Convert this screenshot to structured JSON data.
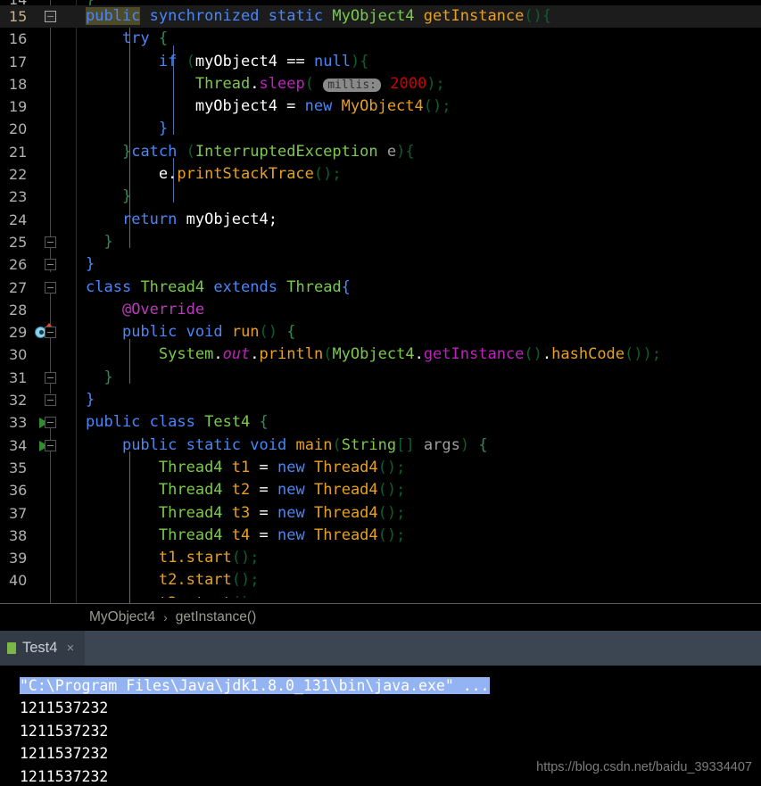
{
  "editor": {
    "current_line": 15,
    "first_partial_line": 14,
    "lines": [
      {
        "num": 15,
        "text": "public synchronized static MyObject4 getInstance(){"
      },
      {
        "num": 16,
        "text": "    try {"
      },
      {
        "num": 17,
        "text": "        if (myObject4 == null){"
      },
      {
        "num": 18,
        "text": "            Thread.sleep( millis: 2000);"
      },
      {
        "num": 19,
        "text": "            myObject4 = new MyObject4();"
      },
      {
        "num": 20,
        "text": "        }"
      },
      {
        "num": 21,
        "text": "    }catch (InterruptedException e){"
      },
      {
        "num": 22,
        "text": "        e.printStackTrace();"
      },
      {
        "num": 23,
        "text": "    }"
      },
      {
        "num": 24,
        "text": "    return myObject4;"
      },
      {
        "num": 25,
        "text": "}"
      },
      {
        "num": 26,
        "text": "}"
      },
      {
        "num": 27,
        "text": "class Thread4 extends Thread{"
      },
      {
        "num": 28,
        "text": "    @Override"
      },
      {
        "num": 29,
        "text": "    public void run() {"
      },
      {
        "num": 30,
        "text": "        System.out.println(MyObject4.getInstance().hashCode());"
      },
      {
        "num": 31,
        "text": "    }"
      },
      {
        "num": 32,
        "text": "}"
      },
      {
        "num": 33,
        "text": "public class Test4 {"
      },
      {
        "num": 34,
        "text": "    public static void main(String[] args) {"
      },
      {
        "num": 35,
        "text": "        Thread4 t1 = new Thread4();"
      },
      {
        "num": 36,
        "text": "        Thread4 t2 = new Thread4();"
      },
      {
        "num": 37,
        "text": "        Thread4 t3 = new Thread4();"
      },
      {
        "num": 38,
        "text": "        Thread4 t4 = new Thread4();"
      },
      {
        "num": 39,
        "text": "        t1.start();"
      },
      {
        "num": 40,
        "text": "        t2.start();"
      }
    ],
    "parameter_hint": "millis:",
    "gutter": {
      "run_marker_lines": [
        33,
        34
      ],
      "override_marker_lines": [
        29
      ],
      "fold_marker_lines": [
        15,
        25,
        26,
        27,
        29,
        31,
        32,
        33,
        34
      ]
    }
  },
  "breadcrumb": {
    "items": [
      "MyObject4",
      "getInstance()"
    ],
    "separator": "›"
  },
  "console_panel": {
    "tab_label": "Test4",
    "tab_close": "×",
    "lines": [
      {
        "text": "\"C:\\Program Files\\Java\\jdk1.8.0_131\\bin\\java.exe\" ...",
        "selected": true
      },
      {
        "text": "1211537232",
        "selected": false
      },
      {
        "text": "1211537232",
        "selected": false
      },
      {
        "text": "1211537232",
        "selected": false
      },
      {
        "text": "1211537232",
        "selected": false
      }
    ]
  },
  "watermark": "https://blog.csdn.net/baidu_39334407",
  "colors": {
    "background": "#000000",
    "current_line": "#1c1c1c",
    "keyword": "#4a86f7",
    "class_name": "#7bc94c",
    "method": "#e8a020",
    "method_magenta": "#c020c0",
    "annotation": "#bb3bbb",
    "number": "#cc0000",
    "selection": "#94b3f2",
    "tabbar": "#3c4552"
  }
}
